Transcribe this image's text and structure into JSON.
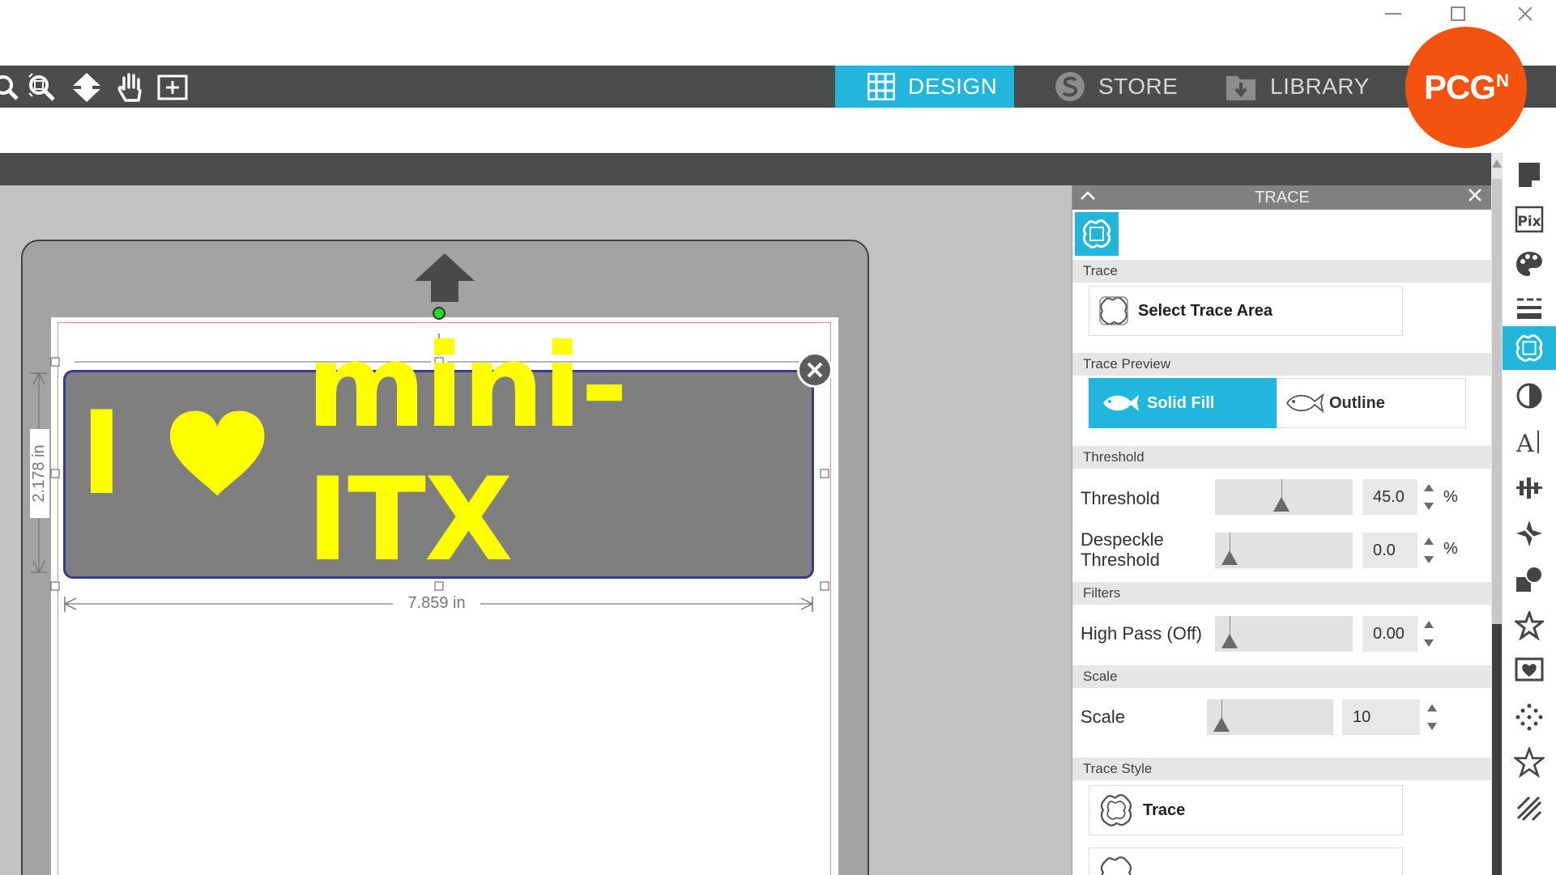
{
  "window": {
    "controls": [
      "minimize",
      "maximize",
      "close"
    ]
  },
  "toolbar": {
    "tools": [
      "zoom-out-icon",
      "zoom-fit-icon",
      "move-down-icon",
      "pan-hand-icon",
      "zoom-area-icon"
    ]
  },
  "nav": {
    "design_label": "DESIGN",
    "store_label": "STORE",
    "library_label": "LIBRARY"
  },
  "logo": {
    "text": "PCG",
    "superscript": "N"
  },
  "design": {
    "text_parts": [
      "I",
      "mini-ITX"
    ],
    "heart_icon": "heart-icon",
    "text_color": "#ffff00",
    "fill_color": "#7f7f7f",
    "width_dim": "7.859 in",
    "height_dim": "2.178 in"
  },
  "panel": {
    "title": "TRACE",
    "sections": {
      "trace": "Trace",
      "trace_preview": "Trace Preview",
      "threshold": "Threshold",
      "filters": "Filters",
      "scale": "Scale",
      "trace_style": "Trace Style"
    },
    "select_trace_area": "Select Trace Area",
    "preview": {
      "solid_fill": "Solid Fill",
      "outline": "Outline",
      "selected": "Solid Fill"
    },
    "threshold": {
      "label": "Threshold",
      "value": "45.0",
      "unit": "%",
      "level": 45
    },
    "despeckle": {
      "label_line1": "Despeckle",
      "label_line2": "Threshold",
      "value": "0.0",
      "unit": "%",
      "level": 0
    },
    "high_pass": {
      "label": "High Pass (Off)",
      "value": "0.00",
      "level": 0
    },
    "scale": {
      "label": "Scale",
      "value": "10",
      "level": 0
    },
    "trace_style": {
      "trace_label": "Trace"
    },
    "accent_color": "#23b6dd"
  }
}
